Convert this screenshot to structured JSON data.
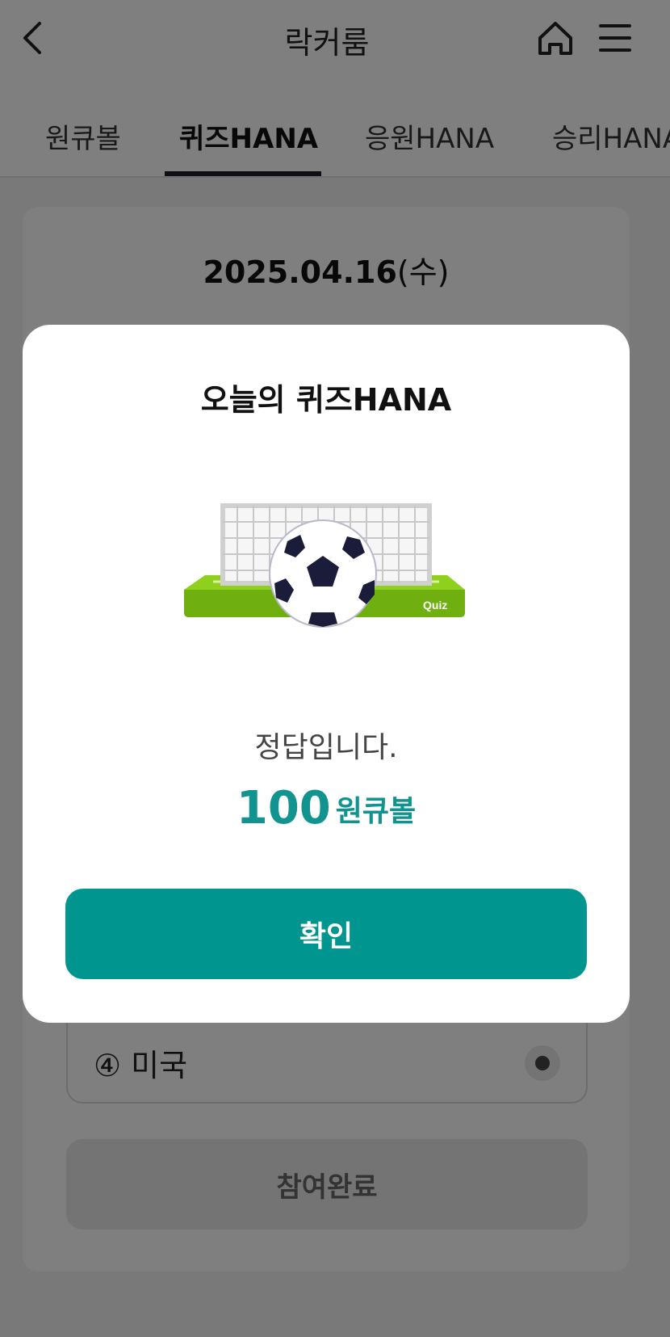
{
  "header": {
    "title": "락커룸",
    "back_icon": "chevron-left-icon",
    "home_icon": "home-icon",
    "menu_icon": "hamburger-menu-icon"
  },
  "tabs": [
    {
      "label": "원큐볼",
      "active": false
    },
    {
      "label": "퀴즈HANA",
      "active": true
    },
    {
      "label": "응원HANA",
      "active": false
    },
    {
      "label": "승리HANA",
      "active": false
    }
  ],
  "quiz": {
    "date": "2025.04.16",
    "day_of_week": "(수)",
    "option4_label": "④ 미국",
    "submit_label": "참여완료"
  },
  "modal": {
    "title": "오늘의 퀴즈HANA",
    "illustration_label": "Quiz",
    "result_text": "정답입니다.",
    "reward_amount": "100",
    "reward_unit": "원큐볼",
    "confirm_label": "확인"
  },
  "colors": {
    "accent": "#00968f",
    "reward_text": "#11938f",
    "tab_indicator": "#1c1c2e"
  }
}
